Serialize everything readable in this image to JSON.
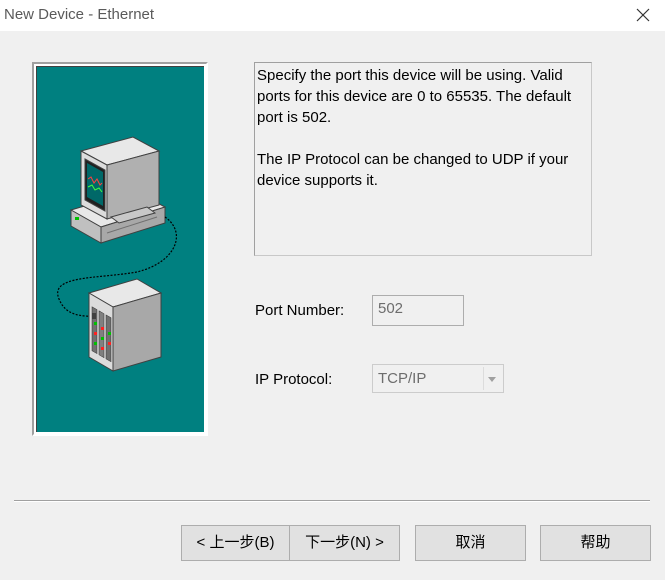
{
  "window": {
    "title": "New Device - Ethernet"
  },
  "description": {
    "para1": "Specify the port this device will be using. Valid ports for this device are 0 to 65535. The default port is 502.",
    "para2": "The IP Protocol can be changed to UDP if your device supports it."
  },
  "fields": {
    "port_label": "Port Number:",
    "port_value": "502",
    "ip_label": "IP Protocol:",
    "ip_value": "TCP/IP"
  },
  "buttons": {
    "back": "< 上一步(B)",
    "next": "下一步(N) >",
    "cancel": "取消",
    "help": "帮助"
  },
  "icons": {
    "close": "close-icon",
    "computer": "computer-icon",
    "device": "network-device-icon"
  },
  "colors": {
    "illustration_bg": "#008080",
    "window_bg": "#f0f0f0",
    "button_bg": "#e1e1e1"
  }
}
